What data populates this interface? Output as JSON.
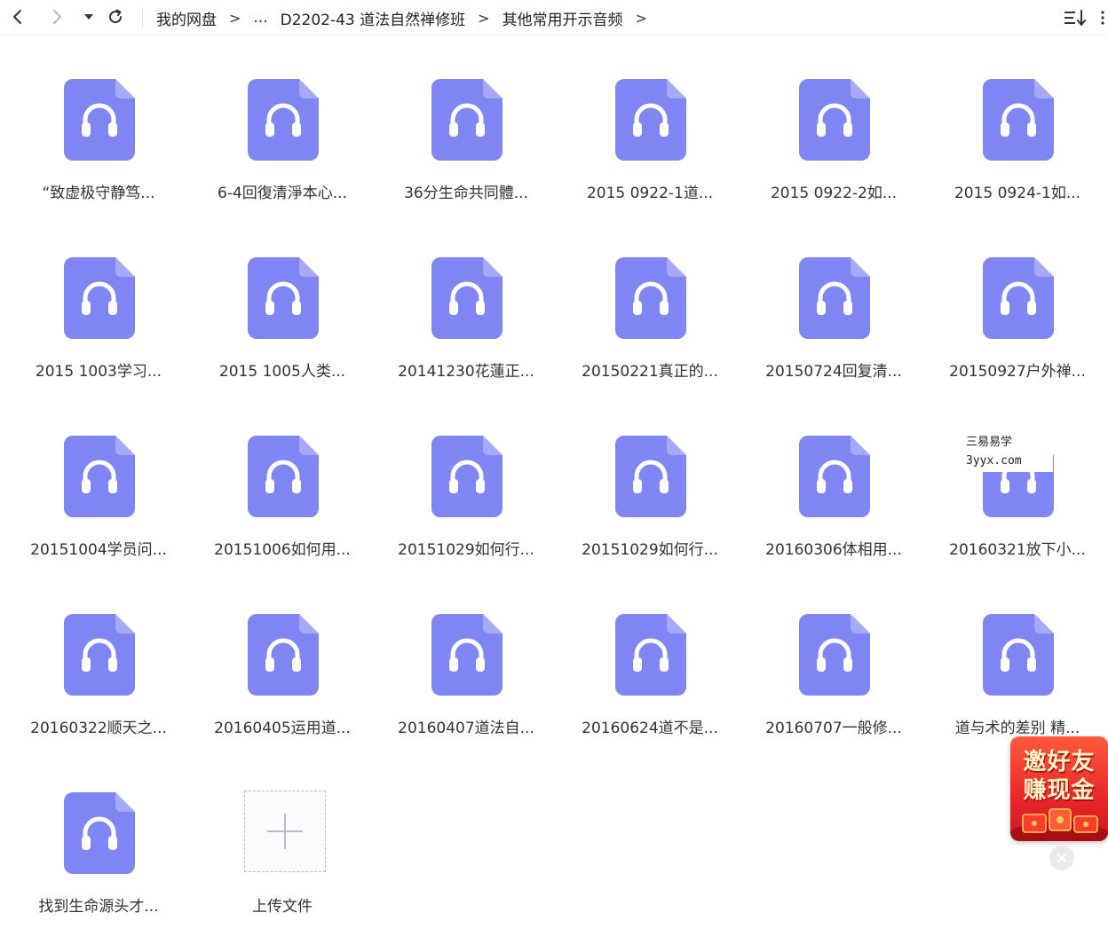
{
  "toolbar": {
    "breadcrumbs": [
      "我的网盘",
      "...",
      "D2202-43 道法自然禅修班",
      "其他常用开示音频"
    ],
    "separator": ">",
    "icons": {
      "back": "chevron-left-icon",
      "forward": "chevron-right-icon",
      "history": "caret-down-icon",
      "refresh": "refresh-icon",
      "sort": "sort-icon",
      "more": "more-icon"
    }
  },
  "files": [
    {
      "name": "“致虚极守静笃..."
    },
    {
      "name": "6-4回復清淨本心..."
    },
    {
      "name": "36分生命共同體..."
    },
    {
      "name": "2015 0922-1道..."
    },
    {
      "name": "2015 0922-2如..."
    },
    {
      "name": "2015 0924-1如..."
    },
    {
      "name": "2015 1003学习..."
    },
    {
      "name": "2015 1005人类..."
    },
    {
      "name": "20141230花蓮正..."
    },
    {
      "name": "20150221真正的..."
    },
    {
      "name": "20150724回复清..."
    },
    {
      "name": "20150927户外禅..."
    },
    {
      "name": "20151004学员问..."
    },
    {
      "name": "20151006如何用..."
    },
    {
      "name": "20151029如何行..."
    },
    {
      "name": "20151029如何行..."
    },
    {
      "name": "20160306体相用..."
    },
    {
      "name": "20160321放下小..."
    },
    {
      "name": "20160322顺天之..."
    },
    {
      "name": "20160405运用道..."
    },
    {
      "name": "20160407道法自..."
    },
    {
      "name": "20160624道不是..."
    },
    {
      "name": "20160707一般修..."
    },
    {
      "name": "道与术的差别 精..."
    },
    {
      "name": "找到生命源头才..."
    }
  ],
  "upload": {
    "label": "上传文件"
  },
  "watermark": {
    "line1": "三易易学",
    "line2": "3yyx.com"
  },
  "promo": {
    "line1": "邀好友",
    "line2": "赚现金"
  },
  "colors": {
    "file_icon": "#7f86f4",
    "file_icon_fold": "#a5aaf8",
    "promo_red": "#e8262a"
  }
}
